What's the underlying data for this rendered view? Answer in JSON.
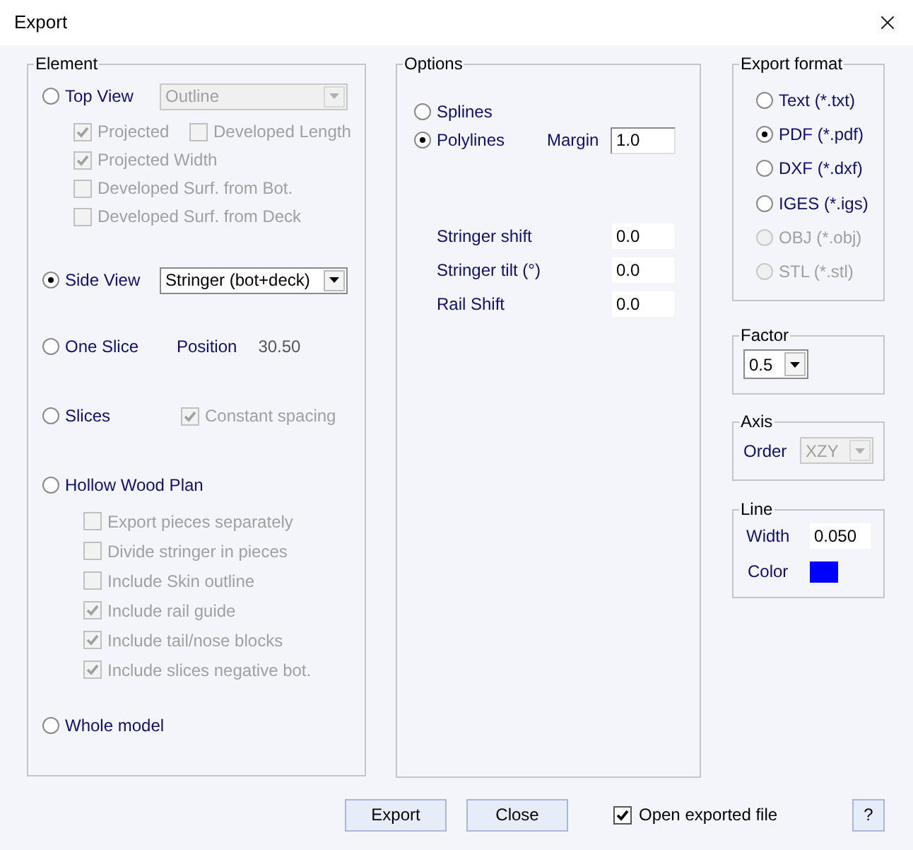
{
  "window": {
    "title": "Export"
  },
  "element": {
    "legend": "Element",
    "options": [
      {
        "label": "Top View",
        "selected": false,
        "combo": {
          "value": "Outline",
          "disabled": true
        },
        "check_rows": [
          {
            "checks": [
              {
                "label": "Projected",
                "checked": true,
                "disabled": true
              },
              {
                "label": "Developed Length",
                "checked": false,
                "disabled": true
              }
            ]
          },
          {
            "checks": [
              {
                "label": "Projected Width",
                "checked": true,
                "disabled": true
              }
            ]
          },
          {
            "checks": [
              {
                "label": "Developed Surf. from Bot.",
                "checked": false,
                "disabled": true
              }
            ]
          },
          {
            "checks": [
              {
                "label": "Developed Surf. from Deck",
                "checked": false,
                "disabled": true
              }
            ]
          }
        ]
      },
      {
        "label": "Side View",
        "selected": true,
        "combo": {
          "value": "Stringer (bot+deck)",
          "disabled": false
        }
      },
      {
        "label": "One Slice",
        "selected": false,
        "position": {
          "label": "Position",
          "value": "30.50"
        }
      },
      {
        "label": "Slices",
        "selected": false,
        "side_check": {
          "label": "Constant spacing",
          "checked": true,
          "disabled": true
        }
      },
      {
        "label": "Hollow Wood Plan",
        "selected": false,
        "check_rows": [
          {
            "checks": [
              {
                "label": "Export pieces separately",
                "checked": false,
                "disabled": true
              }
            ]
          },
          {
            "checks": [
              {
                "label": "Divide stringer in pieces",
                "checked": false,
                "disabled": true
              }
            ]
          },
          {
            "checks": [
              {
                "label": "Include Skin outline",
                "checked": false,
                "disabled": true
              }
            ]
          },
          {
            "checks": [
              {
                "label": "Include rail guide",
                "checked": true,
                "disabled": true
              }
            ]
          },
          {
            "checks": [
              {
                "label": "Include tail/nose blocks",
                "checked": true,
                "disabled": true
              }
            ]
          },
          {
            "checks": [
              {
                "label": "Include slices negative bot.",
                "checked": true,
                "disabled": true
              }
            ]
          }
        ]
      },
      {
        "label": "Whole model",
        "selected": false
      }
    ]
  },
  "options": {
    "legend": "Options",
    "curve_types": [
      {
        "label": "Splines",
        "selected": false
      },
      {
        "label": "Polylines",
        "selected": true
      }
    ],
    "margin": {
      "label": "Margin",
      "value": "1.0"
    },
    "fields": [
      {
        "label": "Stringer shift",
        "value": "0.0"
      },
      {
        "label": "Stringer tilt (°)",
        "value": "0.0"
      },
      {
        "label": "Rail Shift",
        "value": "0.0"
      }
    ]
  },
  "export_format": {
    "legend": "Export format",
    "formats": [
      {
        "label": "Text (*.txt)",
        "selected": false,
        "disabled": false
      },
      {
        "label": "PDF (*.pdf)",
        "selected": true,
        "disabled": false
      },
      {
        "label": "DXF (*.dxf)",
        "selected": false,
        "disabled": false
      },
      {
        "label": "IGES (*.igs)",
        "selected": false,
        "disabled": false
      },
      {
        "label": "OBJ (*.obj)",
        "selected": false,
        "disabled": true
      },
      {
        "label": "STL (*.stl)",
        "selected": false,
        "disabled": true
      }
    ]
  },
  "factor": {
    "legend": "Factor",
    "value": "0.5"
  },
  "axis": {
    "legend": "Axis",
    "label": "Order",
    "value": "XZY",
    "disabled": true
  },
  "line": {
    "legend": "Line",
    "width_label": "Width",
    "width_value": "0.050",
    "color_label": "Color",
    "color": "#0000ff"
  },
  "footer": {
    "buttons": [
      "Export",
      "Close"
    ],
    "open_file": {
      "label": "Open exported file",
      "checked": true
    },
    "help": "?"
  }
}
